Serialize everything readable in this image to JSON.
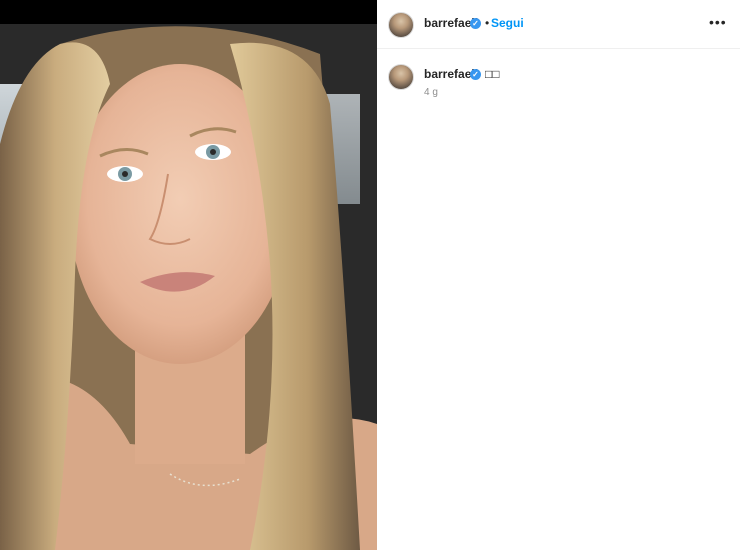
{
  "post": {
    "username": "barrefaeli",
    "follow_label": "Segui",
    "separator": "•",
    "more_label": "•••",
    "verified_glyph": "✓",
    "caption": "□□",
    "time_ago": "4 g"
  },
  "icons": {
    "verified": "verified-badge-icon",
    "more": "more-options-icon"
  },
  "colors": {
    "verified": "#3897f0",
    "follow": "#0095f6",
    "text": "#262626",
    "muted": "#8e8e8e"
  }
}
